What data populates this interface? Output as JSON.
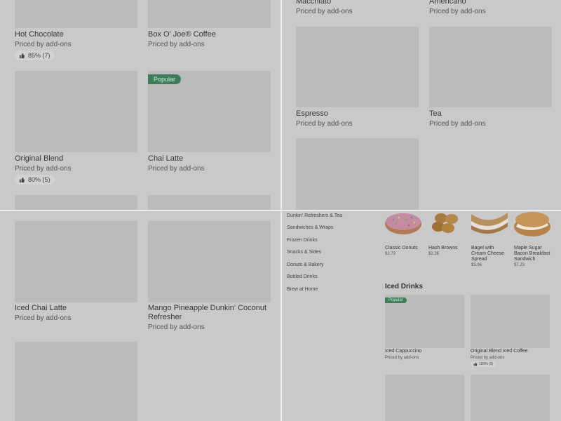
{
  "top_left": {
    "items": [
      {
        "title": "Hot Chocolate",
        "subtitle": "Priced by add-ons",
        "rating": "85% (7)"
      },
      {
        "title": "Box O' Joe® Coffee",
        "subtitle": "Priced by add-ons"
      },
      {
        "title": "Original Blend",
        "subtitle": "Priced by add-ons",
        "rating": "80% (5)"
      },
      {
        "title": "Chai Latte",
        "subtitle": "Priced by add-ons",
        "badge": "Popular"
      }
    ]
  },
  "top_right": {
    "items": [
      {
        "title": "Macchiato",
        "subtitle": "Priced by add-ons"
      },
      {
        "title": "Americano",
        "subtitle": "Priced by add-ons"
      },
      {
        "title": "Espresso",
        "subtitle": "Priced by add-ons"
      },
      {
        "title": "Tea",
        "subtitle": "Priced by add-ons"
      }
    ]
  },
  "bottom_left": {
    "items": [
      {
        "title": "Iced Chai Latte",
        "subtitle": "Priced by add-ons"
      },
      {
        "title": "Mango Pineapple Dunkin' Coconut Refresher",
        "subtitle": "Priced by add-ons"
      }
    ]
  },
  "bottom_right": {
    "nav": [
      "Dunkin' Refreshers & Tea",
      "Sandwiches & Wraps",
      "Frozen Drinks",
      "Snacks & Sides",
      "Donuts & Bakery",
      "Bottled Drinks",
      "Brew at Home"
    ],
    "top_items": [
      {
        "title": "Classic Donuts",
        "price": "$2.73"
      },
      {
        "title": "Hash Browns",
        "price": "$2.36"
      },
      {
        "title": "Bagel with Cream Cheese Spread",
        "price": "$3.96"
      },
      {
        "title": "Maple Sugar Bacon Breakfast Sandwich",
        "price": "$7.23"
      }
    ],
    "section_title": "Iced Drinks",
    "iced_items": [
      {
        "title": "Iced Cappuccino",
        "subtitle": "Priced by add-ons",
        "badge": "Popular"
      },
      {
        "title": "Original Blend Iced Coffee",
        "subtitle": "Priced by add-ons",
        "rating": "100% (9)"
      }
    ]
  }
}
